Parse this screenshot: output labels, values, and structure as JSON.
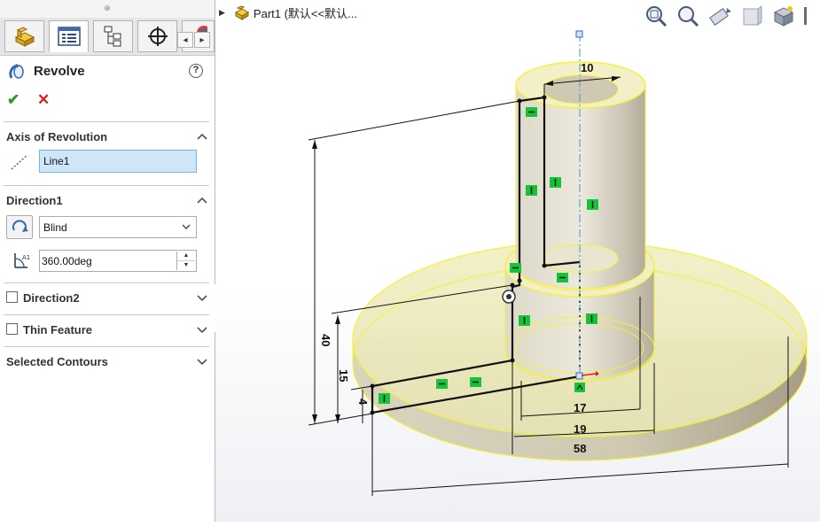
{
  "property_manager": {
    "title": "Revolve",
    "help": "?",
    "ok": "✔",
    "cancel": "✕",
    "axis_of_revolution": {
      "title": "Axis of Revolution",
      "value": "Line1"
    },
    "direction1": {
      "title": "Direction1",
      "type": "Blind",
      "angle": "360.00deg"
    },
    "direction2": {
      "title": "Direction2"
    },
    "thin_feature": {
      "title": "Thin Feature"
    },
    "selected_contours": {
      "title": "Selected Contours"
    },
    "tab_arrows": {
      "left": "◂",
      "right": "▸"
    }
  },
  "feature_tree": {
    "label": "Part1  (默认<<默认..."
  },
  "dimensions": {
    "d10": "10",
    "d40": "40",
    "d15": "15",
    "d4": "4",
    "d17": "17",
    "d19": "19",
    "d58": "58"
  },
  "colors": {
    "shaded_part": "#e8e6cf",
    "edge_highlight": "#f5f03a",
    "relation_marker": "#16c23a",
    "axis": "#4a8fd6"
  }
}
